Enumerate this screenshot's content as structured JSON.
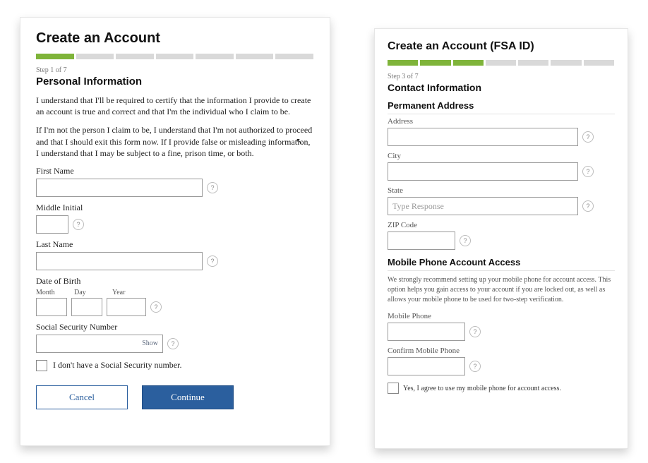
{
  "left_panel": {
    "title": "Create an Account",
    "progress": {
      "current": 1,
      "total": 7
    },
    "step_label": "Step 1 of 7",
    "section_title": "Personal Information",
    "disclaimer_1": "I understand that I'll be required to certify that the information I provide to create an account is true and correct and that I'm the individual who I claim to be.",
    "disclaimer_2": "If I'm not the person I claim to be, I understand that I'm not authorized to proceed and that I should exit this form now. If I provide false or misleading information, I understand that I may be subject to a fine, prison time, or both.",
    "fields": {
      "first_name_label": "First Name",
      "middle_initial_label": "Middle Initial",
      "last_name_label": "Last Name",
      "dob_label": "Date of Birth",
      "dob_month": "Month",
      "dob_day": "Day",
      "dob_year": "Year",
      "ssn_label": "Social Security Number",
      "ssn_show": "Show",
      "no_ssn_label": "I don't have a Social Security number."
    },
    "buttons": {
      "cancel": "Cancel",
      "continue": "Continue"
    }
  },
  "right_panel": {
    "title": "Create an Account (FSA ID)",
    "progress": {
      "current": 3,
      "total": 7
    },
    "step_label": "Step 3 of 7",
    "section_title": "Contact Information",
    "address_section": "Permanent Address",
    "fields": {
      "address_label": "Address",
      "city_label": "City",
      "state_label": "State",
      "state_placeholder": "Type Response",
      "zip_label": "ZIP Code"
    },
    "mobile_section": "Mobile Phone Account Access",
    "mobile_note": "We strongly recommend setting up your mobile phone for account access. This option helps you gain access to your account if you are locked out, as well as allows your mobile phone to be used for two-step verification.",
    "mobile_fields": {
      "mobile_label": "Mobile Phone",
      "confirm_mobile_label": "Confirm Mobile Phone",
      "agree_label": "Yes, I agree to use my mobile phone for account access."
    }
  },
  "help_glyph": "?"
}
